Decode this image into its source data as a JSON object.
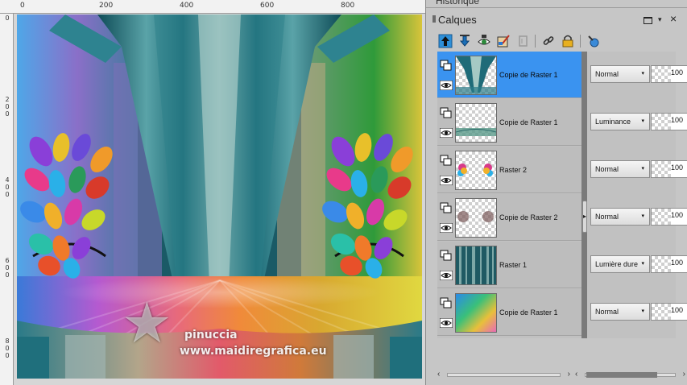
{
  "rulers": {
    "top_labels": [
      "0",
      "200",
      "400",
      "600",
      "800"
    ],
    "left_labels": [
      "0",
      "2\n0\n0",
      "4\n0\n0",
      "6\n0\n0",
      "8\n0\n0"
    ]
  },
  "watermark": {
    "name": "pinuccia",
    "url": "www.maidiregrafica.eu"
  },
  "panel": {
    "historique_title": "Historique",
    "title": "Calques",
    "menu_arrow": "▾",
    "close_glyph": "×"
  },
  "toolbar": {
    "items": [
      {
        "icon": "move-layer-up-icon"
      },
      {
        "icon": "move-layer-down-icon"
      },
      {
        "icon": "layer-visibility-icon"
      },
      {
        "icon": "layer-properties-icon"
      },
      {
        "icon": "delete-layer-icon"
      },
      {
        "icon": "link-layers-icon"
      },
      {
        "icon": "lock-transparency-icon"
      },
      {
        "icon": "new-layer-dropper-icon"
      }
    ]
  },
  "layers": [
    {
      "name": "Copie de Raster 1",
      "blend": "Normal",
      "opacity": "100",
      "selected": true
    },
    {
      "name": "Copie de Raster 1",
      "blend": "Luminance",
      "opacity": "100",
      "selected": false
    },
    {
      "name": "Raster 2",
      "blend": "Normal",
      "opacity": "100",
      "selected": false
    },
    {
      "name": "Copie de Raster 2",
      "blend": "Normal",
      "opacity": "100",
      "selected": false
    },
    {
      "name": "Raster 1",
      "blend": "Lumière dure",
      "opacity": "100",
      "selected": false
    },
    {
      "name": "Copie de Raster 1",
      "blend": "Normal",
      "opacity": "100",
      "selected": false
    }
  ],
  "colors": {
    "selected_row": "#3a93f0",
    "panel_bg": "#c6c6c6",
    "teal": "#1f6b78"
  }
}
